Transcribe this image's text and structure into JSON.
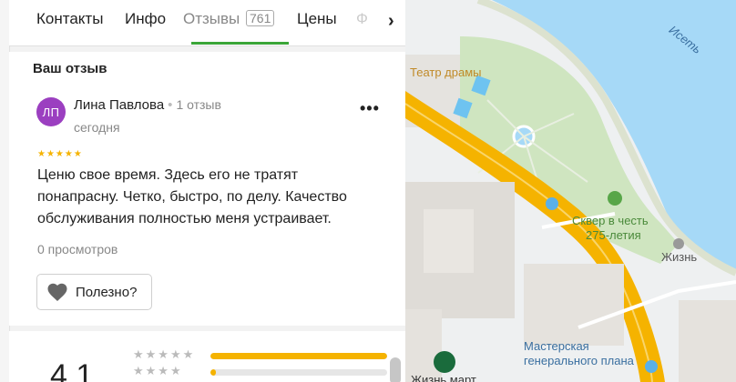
{
  "tabs": [
    {
      "label": "Контакты"
    },
    {
      "label": "Инфо"
    },
    {
      "label": "Отзывы",
      "count": "761",
      "active": true
    },
    {
      "label": "Цены"
    },
    {
      "label": "Ф"
    }
  ],
  "my_review": {
    "section_title": "Ваш отзыв",
    "avatar_initials": "ЛП",
    "author_name": "Лина Павлова",
    "author_reviews": "1 отзыв",
    "date": "сегодня",
    "stars": "★★★★★",
    "text": "Ценю свое время. Здесь его не тратят понапрасну. Четко, быстро, по делу. Качество обслуживания полностью меня устраивает.",
    "views": "0 просмотров",
    "useful_label": "Полезно?"
  },
  "rating": {
    "value": "4,1",
    "rows": [
      {
        "stars": "★★★★★",
        "fraction": 1.0
      },
      {
        "stars": "★★★★",
        "fraction": 0.03
      }
    ]
  },
  "map": {
    "labels": {
      "theatre": "Театр драмы",
      "park_line1": "Сквер в честь",
      "park_line2": "275-летия",
      "river": "Исеть",
      "life": "Жизнь",
      "masters_line1": "Мастерская",
      "masters_line2": "генерального плана",
      "zhiznmart": "Жизнь март"
    }
  },
  "colors": {
    "accent_green": "#3ba638",
    "star": "#f5b300",
    "avatar": "#9b3fc0",
    "road": "#f5b300",
    "water": "#a6d9f7",
    "park": "#cfe5c0"
  }
}
